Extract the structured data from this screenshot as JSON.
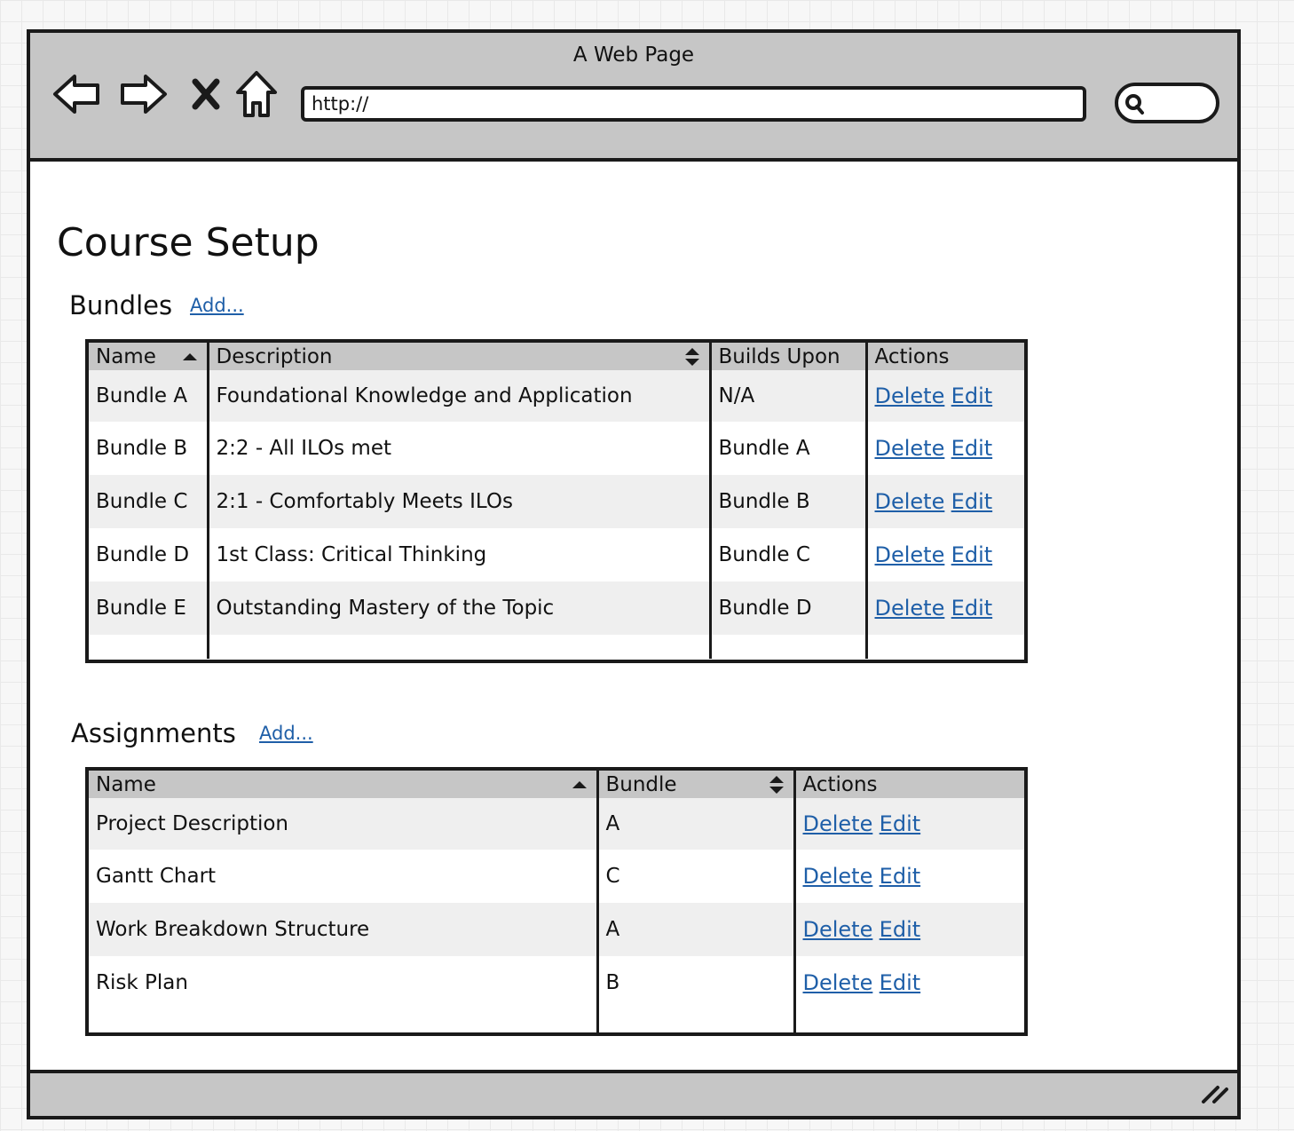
{
  "window": {
    "title": "A Web Page"
  },
  "toolbar": {
    "back_icon": "arrow-left-icon",
    "forward_icon": "arrow-right-icon",
    "stop_icon": "close-icon",
    "home_icon": "home-icon",
    "url_value": "http://",
    "search_icon": "search-icon"
  },
  "page": {
    "title": "Course Setup"
  },
  "bundles": {
    "heading": "Bundles",
    "add_label": "Add...",
    "columns": [
      "Name",
      "Description",
      "Builds Upon",
      "Actions"
    ],
    "rows": [
      {
        "name": "Bundle A",
        "description": "Foundational Knowledge and Application",
        "builds_upon": "N/A",
        "delete": "Delete",
        "edit": "Edit"
      },
      {
        "name": "Bundle B",
        "description": "2:2 - All ILOs met",
        "builds_upon": "Bundle A",
        "delete": "Delete",
        "edit": "Edit"
      },
      {
        "name": "Bundle C",
        "description": "2:1 - Comfortably Meets ILOs",
        "builds_upon": "Bundle B",
        "delete": "Delete",
        "edit": "Edit"
      },
      {
        "name": "Bundle D",
        "description": "1st Class: Critical Thinking",
        "builds_upon": "Bundle C",
        "delete": "Delete",
        "edit": "Edit"
      },
      {
        "name": "Bundle E",
        "description": "Outstanding Mastery of the Topic",
        "builds_upon": "Bundle D",
        "delete": "Delete",
        "edit": "Edit"
      }
    ]
  },
  "assignments": {
    "heading": "Assignments",
    "add_label": "Add...",
    "columns": [
      "Name",
      "Bundle",
      "Actions"
    ],
    "rows": [
      {
        "name": "Project Description",
        "bundle": "A",
        "delete": "Delete",
        "edit": "Edit"
      },
      {
        "name": "Gantt Chart",
        "bundle": "C",
        "delete": "Delete",
        "edit": "Edit"
      },
      {
        "name": "Work Breakdown Structure",
        "bundle": "A",
        "delete": "Delete",
        "edit": "Edit"
      },
      {
        "name": "Risk Plan",
        "bundle": "B",
        "delete": "Delete",
        "edit": "Edit"
      }
    ]
  },
  "colors": {
    "chrome": "#c6c6c6",
    "link": "#1f5fa8",
    "row_alt": "#efefef",
    "border": "#1a1a1a"
  }
}
